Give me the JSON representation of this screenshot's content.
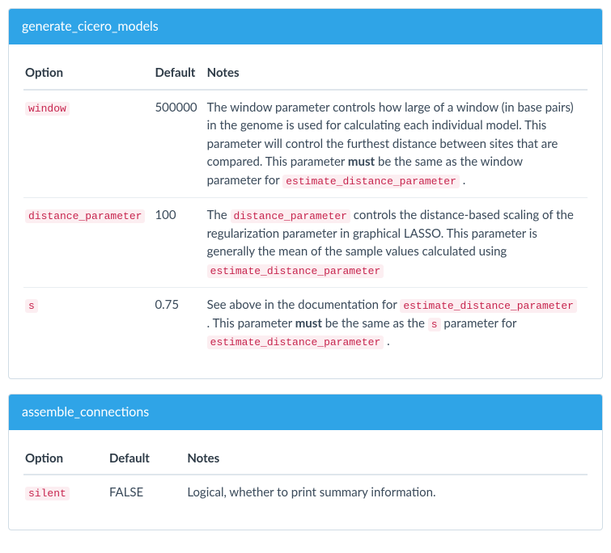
{
  "sections": [
    {
      "title": "generate_cicero_models",
      "headers": {
        "option": "Option",
        "default": "Default",
        "notes": "Notes"
      },
      "rows": [
        {
          "option": "window",
          "default": "500000",
          "notes": [
            {
              "t": "text",
              "v": "The window parameter controls how large of a window (in base pairs) in the genome is used for calculating each individual model. This parameter will control the furthest distance between sites that are compared. This parameter "
            },
            {
              "t": "strong",
              "v": "must"
            },
            {
              "t": "text",
              "v": " be the same as the window parameter for "
            },
            {
              "t": "code",
              "v": "estimate_distance_parameter"
            },
            {
              "t": "text",
              "v": " ."
            }
          ]
        },
        {
          "option": "distance_parameter",
          "default": "100",
          "notes": [
            {
              "t": "text",
              "v": "The "
            },
            {
              "t": "code",
              "v": "distance_parameter"
            },
            {
              "t": "text",
              "v": " controls the distance-based scaling of the regularization parameter in graphical LASSO. This parameter is generally the mean of the sample values calculated using "
            },
            {
              "t": "code",
              "v": "estimate_distance_parameter"
            }
          ]
        },
        {
          "option": "s",
          "default": "0.75",
          "notes": [
            {
              "t": "text",
              "v": "See above in the documentation for "
            },
            {
              "t": "code",
              "v": "estimate_distance_parameter"
            },
            {
              "t": "text",
              "v": " . This parameter "
            },
            {
              "t": "strong",
              "v": "must"
            },
            {
              "t": "text",
              "v": " be the same as the "
            },
            {
              "t": "code",
              "v": "s"
            },
            {
              "t": "text",
              "v": " parameter for "
            },
            {
              "t": "code",
              "v": "estimate_distance_parameter"
            },
            {
              "t": "text",
              "v": " ."
            }
          ]
        }
      ]
    },
    {
      "title": "assemble_connections",
      "headers": {
        "option": "Option",
        "default": "Default",
        "notes": "Notes"
      },
      "rows": [
        {
          "option": "silent",
          "default": "FALSE",
          "notes": [
            {
              "t": "text",
              "v": "Logical, whether to print summary information."
            }
          ]
        }
      ]
    }
  ]
}
